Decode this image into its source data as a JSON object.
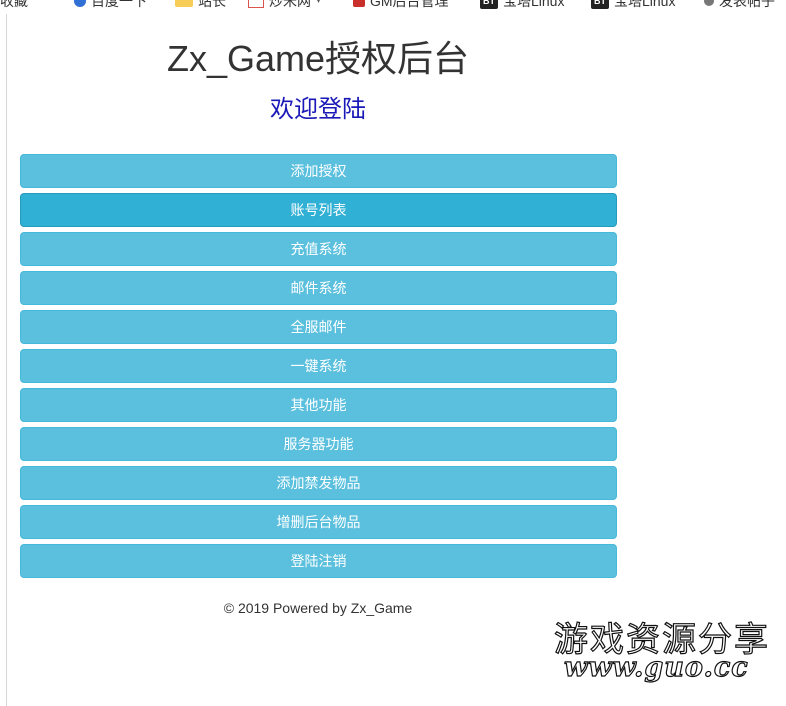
{
  "bookmarks": [
    {
      "label": "收藏",
      "icon": "none"
    },
    {
      "label": "百度一下",
      "icon": "baidu-icon"
    },
    {
      "label": "站长",
      "icon": "folder-icon"
    },
    {
      "label": "炒米网",
      "icon": "site-icon",
      "has_dropdown": true
    },
    {
      "label": "GM后台管理",
      "icon": "gm-icon"
    },
    {
      "label": "宝塔Linux",
      "icon": "bt-icon"
    },
    {
      "label": "宝塔Linux",
      "icon": "bt-icon"
    },
    {
      "label": "发表帖子",
      "icon": "post-icon"
    }
  ],
  "header": {
    "title": "Zx_Game授权后台",
    "subtitle": "欢迎登陆"
  },
  "menu": {
    "items": [
      {
        "label": "添加授权"
      },
      {
        "label": "账号列表",
        "active": true
      },
      {
        "label": "充值系统"
      },
      {
        "label": "邮件系统"
      },
      {
        "label": "全服邮件"
      },
      {
        "label": "一键系统"
      },
      {
        "label": "其他功能"
      },
      {
        "label": "服务器功能"
      },
      {
        "label": "添加禁发物品"
      },
      {
        "label": "增删后台物品"
      },
      {
        "label": "登陆注销"
      }
    ]
  },
  "footer": {
    "text": "© 2019 Powered by Zx_Game"
  },
  "watermark": {
    "line1": "游戏资源分享",
    "line2": "www.guo.cc"
  },
  "colors": {
    "button": "#5bc0de",
    "button_active": "#31b0d5",
    "subtitle": "#1a19b8"
  }
}
